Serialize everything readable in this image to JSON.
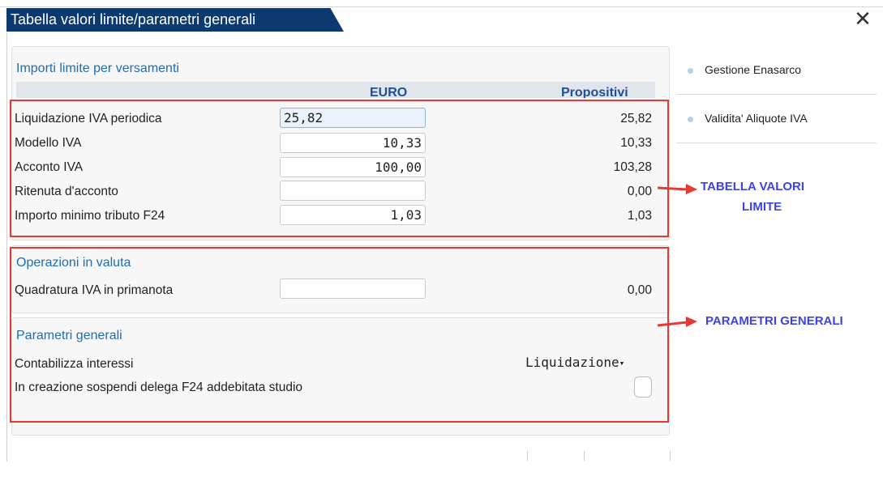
{
  "window": {
    "title": "Tabella valori limite/parametri generali",
    "close_glyph": "✕"
  },
  "importi": {
    "title": "Importi limite per versamenti",
    "col_euro": "EURO",
    "col_propositivi": "Propositivi",
    "rows": [
      {
        "label": "Liquidazione IVA periodica",
        "euro": "25,82",
        "propositivi": "25,82"
      },
      {
        "label": "Modello IVA",
        "euro": "10,33",
        "propositivi": "10,33"
      },
      {
        "label": "Acconto IVA",
        "euro": "100,00",
        "propositivi": "103,28"
      },
      {
        "label": "Ritenuta d'acconto",
        "euro": "",
        "propositivi": "0,00"
      },
      {
        "label": "Importo minimo tributo F24",
        "euro": "1,03",
        "propositivi": "1,03"
      }
    ]
  },
  "valuta": {
    "title": "Operazioni in valuta",
    "row": {
      "label": "Quadratura IVA in primanota",
      "euro": "",
      "propositivi": "0,00"
    }
  },
  "parametri": {
    "title": "Parametri generali",
    "interessi_label": "Contabilizza interessi",
    "interessi_value": "Liquidazione",
    "caret_glyph": "▾",
    "sospendi_label": "In creazione sospendi delega F24 addebitata studio",
    "sospendi_checked": false
  },
  "side_menu": [
    {
      "label": "Gestione Enasarco"
    },
    {
      "label": "Validita' Aliquote IVA"
    }
  ],
  "annotations": {
    "tabella_line1": "TABELLA VALORI",
    "tabella_line2": "LIMITE",
    "parametri": "PARAMETRI GENERALI"
  },
  "colors": {
    "title_bar": "#0d3a6e",
    "section_title": "#1f6db0",
    "highlight_box": "#e53935",
    "annotation_text": "#3d43e6"
  }
}
